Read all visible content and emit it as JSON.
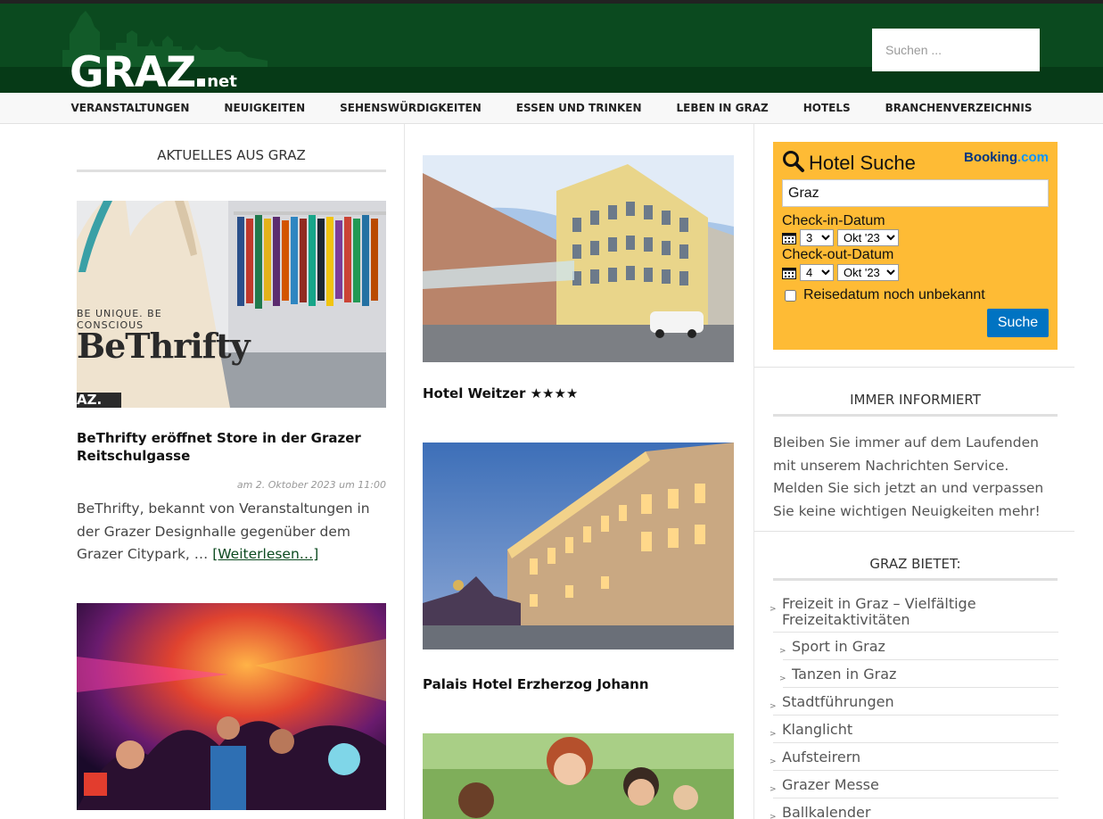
{
  "site": {
    "logo_main": "GRAZ",
    "logo_suffix": "net",
    "search_placeholder": "Suchen ..."
  },
  "nav": {
    "items": [
      "VERANSTALTUNGEN",
      "NEUIGKEITEN",
      "SEHENSWÜRDIGKEITEN",
      "ESSEN UND TRINKEN",
      "LEBEN IN GRAZ",
      "HOTELS",
      "BRANCHENVERZEICHNIS"
    ]
  },
  "left": {
    "widget_title": "AKTUELLES AUS GRAZ",
    "post1": {
      "image_bag_line1": "BE UNIQUE. BE CONSCIOUS",
      "image_bag_line2": "BeThrifty",
      "image_watermark": "AZ.",
      "title": "BeThrifty eröffnet Store in der Grazer Reitschulgasse",
      "meta": "am 2. Oktober 2023 um 11:00",
      "excerpt": "BeThrifty, bekannt von Veranstaltungen in der Grazer Designhalle gegenüber dem Grazer Citypark, …",
      "read_more": "[Weiterlesen…]"
    }
  },
  "middle": {
    "post1_title": "Hotel Weitzer ★★★★",
    "post2_title": "Palais Hotel Erzherzog Johann"
  },
  "booking": {
    "title": "Hotel Suche",
    "logo_part1": "Booking",
    "logo_part2": ".com",
    "destination": "Graz",
    "checkin_label": "Check-in-Datum",
    "checkin_day": "3",
    "checkin_month": "Okt '23",
    "checkout_label": "Check-out-Datum",
    "checkout_day": "4",
    "checkout_month": "Okt '23",
    "unknown_dates_label": "Reisedatum noch unbekannt",
    "button": "Suche",
    "colors": {
      "panel": "#febb35",
      "button": "#0073c2"
    }
  },
  "sidebar": {
    "newsletter_title": "IMMER INFORMIERT",
    "newsletter_text": "Bleiben Sie immer auf dem Laufenden mit unserem Nachrichten Service. Melden Sie sich jetzt an und verpassen Sie keine wichtigen Neuigkeiten mehr!",
    "offers_title": "GRAZ BIETET:",
    "offers": [
      {
        "label": "Freizeit in Graz – Vielfältige Freizeitaktivitäten",
        "level": 0
      },
      {
        "label": "Sport in Graz",
        "level": 1
      },
      {
        "label": "Tanzen in Graz",
        "level": 1
      },
      {
        "label": "Stadtführungen",
        "level": 0
      },
      {
        "label": "Klanglicht",
        "level": 0
      },
      {
        "label": "Aufsteirern",
        "level": 0
      },
      {
        "label": "Grazer Messe",
        "level": 0
      },
      {
        "label": "Ballkalender",
        "level": 0
      }
    ]
  },
  "theme": {
    "header_green": "#0b4a1f",
    "header_band": "#063a17"
  }
}
